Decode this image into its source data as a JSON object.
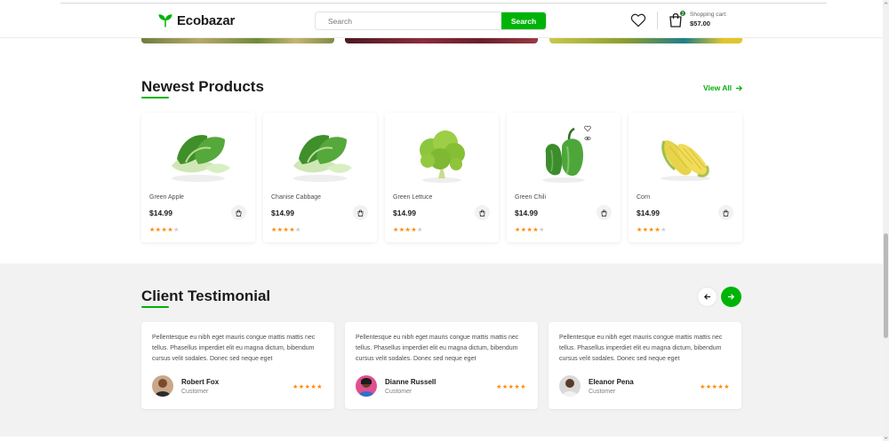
{
  "header": {
    "logo_text": "Ecobazar",
    "search_placeholder": "Search",
    "search_button": "Search",
    "cart_label": "Shopping cart:",
    "cart_total": "$57.00",
    "cart_count": "2"
  },
  "newest": {
    "title": "Newest Products",
    "view_all": "View All",
    "products": [
      {
        "name": "Green Apple",
        "price": "$14.99",
        "rating": 4
      },
      {
        "name": "Chanise Cabbage",
        "price": "$14.99",
        "rating": 4
      },
      {
        "name": "Green Lettuce",
        "price": "$14.99",
        "rating": 4
      },
      {
        "name": "Green Chili",
        "price": "$14.99",
        "rating": 4
      },
      {
        "name": "Corn",
        "price": "$14.99",
        "rating": 4
      }
    ]
  },
  "testimonial": {
    "title": "Client Testimonial",
    "items": [
      {
        "quote": "Pellentesque eu nibh eget mauris congue mattis mattis nec tellus. Phasellus imperdiet elit eu magna dictum, bibendum cursus velit sodales. Donec sed neque eget",
        "name": "Robert Fox",
        "role": "Customer",
        "rating": 5
      },
      {
        "quote": "Pellentesque eu nibh eget mauris congue mattis mattis nec tellus. Phasellus imperdiet elit eu magna dictum, bibendum cursus velit sodales. Donec sed neque eget",
        "name": "Dianne Russell",
        "role": "Customer",
        "rating": 5
      },
      {
        "quote": "Pellentesque eu nibh eget mauris congue mattis mattis nec tellus. Phasellus imperdiet elit eu magna dictum, bibendum cursus velit sodales. Donec sed neque eget",
        "name": "Eleanor Pena",
        "role": "Customer",
        "rating": 5
      }
    ]
  },
  "colors": {
    "brand_green": "#00b307",
    "star_orange": "#ff8a00"
  },
  "icons": [
    "leaf-logo-icon",
    "heart-icon",
    "shopping-bag-icon",
    "arrow-right-icon",
    "arrow-left-icon",
    "bag-add-icon",
    "eye-icon"
  ]
}
